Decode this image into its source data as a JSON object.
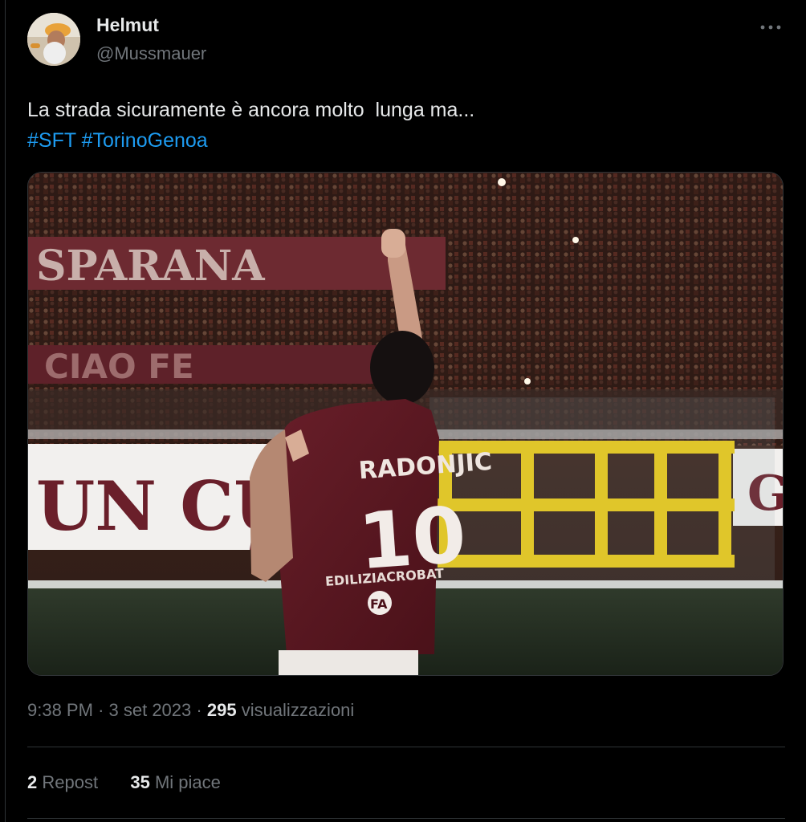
{
  "author": {
    "name": "Helmut",
    "handle": "@Mussmauer"
  },
  "tweet": {
    "text": "La strada sicuramente è ancora molto  lunga ma...",
    "hashtags": [
      "#SFT",
      "#TorinoGenoa"
    ]
  },
  "media": {
    "banner_top": "SPARANA",
    "banner_mid": "CIAO FE",
    "banner_low": "UN CUO",
    "banner_right": "G",
    "jersey_name": "RADONJIC",
    "jersey_number": "10",
    "sponsor": "EDILIZIACROBAT",
    "badge": "FA"
  },
  "meta": {
    "time": "9:38 PM",
    "date": "3 set 2023",
    "views_count": "295",
    "views_label": "visualizzazioni"
  },
  "stats": {
    "reposts_count": "2",
    "reposts_label": "Repost",
    "likes_count": "35",
    "likes_label": "Mi piace"
  },
  "colors": {
    "background": "#000000",
    "text": "#e7e9ea",
    "secondary": "#71767b",
    "link": "#1d9bf0",
    "divider": "#2f3336"
  }
}
